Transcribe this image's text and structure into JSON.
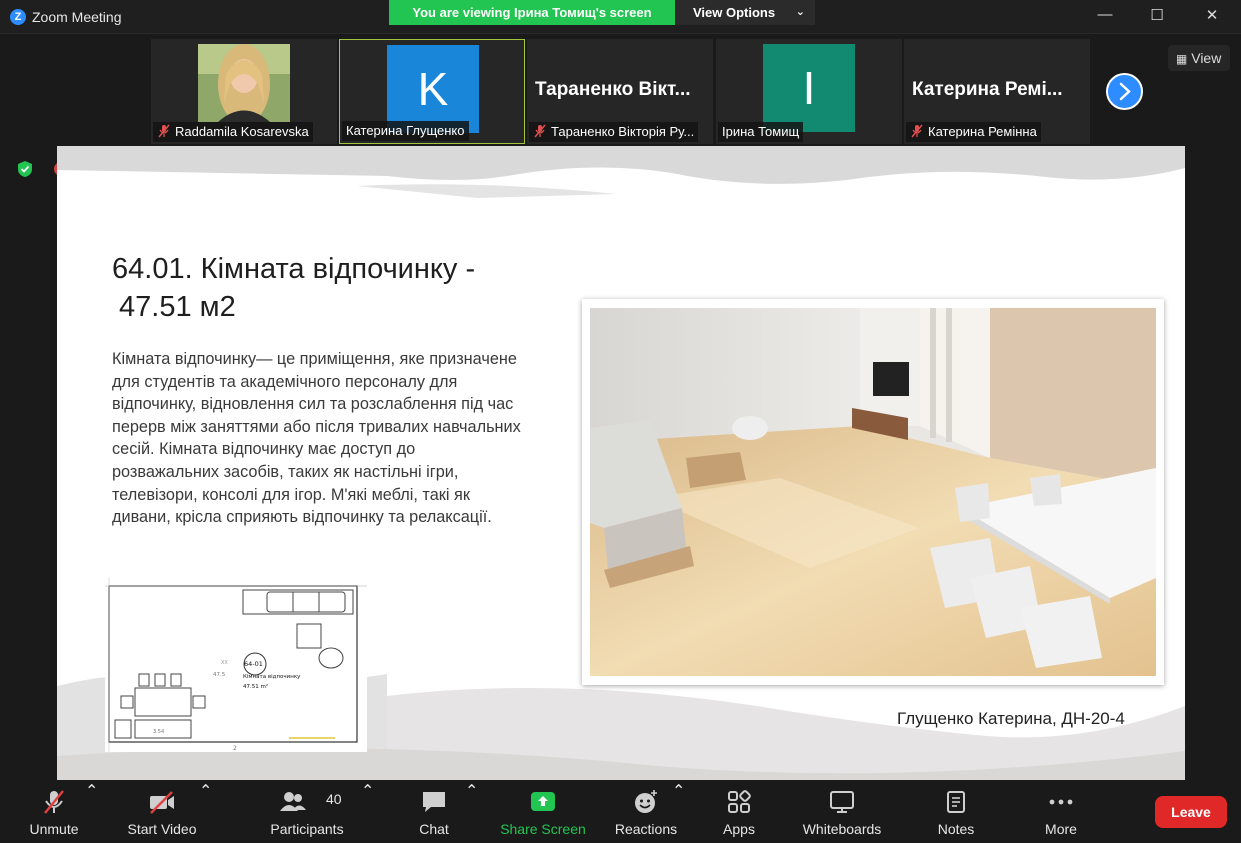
{
  "window": {
    "logo_letter": "Z",
    "title": "Zoom Meeting",
    "controls": {
      "minimize": "—",
      "maximize": "☐",
      "close": "✕"
    }
  },
  "banner": {
    "viewing_text": "You are viewing Ірина Томищ's screen",
    "view_options_label": "View Options"
  },
  "strip": {
    "view_label": "View",
    "participants": [
      {
        "name": "Raddamila Kosarevska",
        "kind": "photo",
        "muted": true
      },
      {
        "name": "Катерина Глущенко",
        "kind": "initial",
        "initial": "K",
        "color": "#1a86d9",
        "muted": false,
        "active": true
      },
      {
        "name": "Тараненко Вікторія Ру...",
        "kind": "name",
        "display_name": "Тараненко Вікт...",
        "muted": true
      },
      {
        "name": "Ірина Томищ",
        "kind": "initial",
        "initial": "I",
        "color": "#128a72",
        "muted": false
      },
      {
        "name": "Катерина Ремінна",
        "kind": "name",
        "display_name": "Катерина Ремі...",
        "muted": true
      }
    ]
  },
  "slide": {
    "title_line1": "64.01. Кімната відпочинку -",
    "title_line2": "47.51 м2",
    "body": "Кімната відпочинку— це приміщення, яке призначене для студентів та академічного персоналу для відпочинку, відновлення сил та розслаблення під час перерв між заняттями або після тривалих навчальних сесій. Кімната відпочинку має доступ до розважальних засобів, таких як настільні ігри, телевізори, консолі для ігор. М'які меблі, такі як дивани, крісла сприяють відпочинку та релаксації.",
    "caption": "Глущенко Катерина, ДН-20-4",
    "plan": {
      "room_code": "64-01",
      "room_name": "Кімната відпочинку",
      "room_area": "47.51 m²",
      "dim_left": "47.5",
      "dim_small": "XX",
      "dim_bottom": "2",
      "dim_box": "3.54"
    }
  },
  "toolbar": {
    "unmute": "Unmute",
    "start_video": "Start Video",
    "participants": "Participants",
    "participants_count": "40",
    "chat": "Chat",
    "share_screen": "Share Screen",
    "reactions": "Reactions",
    "apps": "Apps",
    "whiteboards": "Whiteboards",
    "notes": "Notes",
    "more": "More",
    "leave": "Leave"
  },
  "colors": {
    "accent_blue": "#2d8cff",
    "banner_green": "#23c552",
    "leave_red": "#e02828",
    "share_green": "#23c552",
    "active_tile_border": "#a3c43c"
  }
}
